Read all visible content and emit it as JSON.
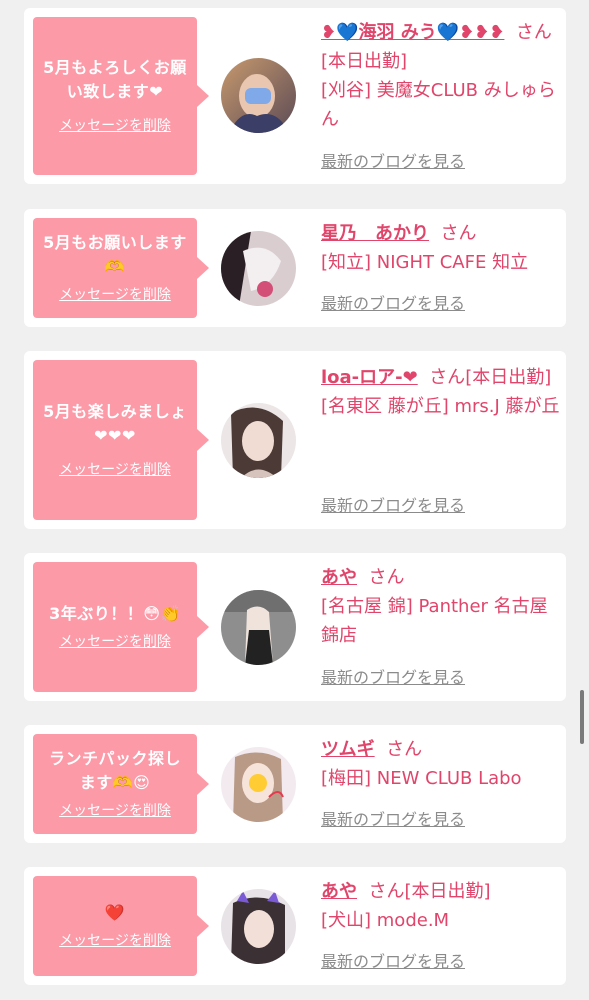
{
  "colors": {
    "page_background": "#f0f0f1",
    "card_background": "#ffffff",
    "bubble_background": "#fc9aa8",
    "accent_pink": "#e0456b",
    "link_gray": "#8b8b8b"
  },
  "labels": {
    "delete_message": "メッセージを削除",
    "latest_blog": "最新のブログを見る",
    "honorific": "さん"
  },
  "entries": [
    {
      "message": "5月もよろしくお願い致します❤",
      "name": "❥💙海羽 みう💙❥❥❥",
      "status": "[本日出勤]",
      "location": "[刈谷] 美魔女CLUB みしゅらん",
      "avatar_icon": "photo-avatar-icon"
    },
    {
      "message": "5月もお願いします🫶",
      "name": "星乃　あかり",
      "status": "",
      "location": "[知立] NIGHT CAFE 知立",
      "avatar_icon": "photo-avatar-icon"
    },
    {
      "message": "5月も楽しみましょ❤❤❤",
      "name": "loa-ロア-❤",
      "status": "[本日出勤]",
      "location": "[名東区 藤が丘] mrs.J 藤が丘",
      "avatar_icon": "photo-avatar-icon"
    },
    {
      "message": "3年ぶり！！😳👏",
      "name": "あや",
      "status": "",
      "location": "[名古屋 錦] Panther 名古屋錦店",
      "avatar_icon": "photo-avatar-icon"
    },
    {
      "message": "ランチパック探します🫶😍",
      "name": "ツムギ",
      "status": "",
      "location": "[梅田] NEW CLUB Labo",
      "avatar_icon": "photo-avatar-icon"
    },
    {
      "message": "❤️",
      "name": "あや",
      "status": "[本日出勤]",
      "location": "[犬山] mode.M",
      "avatar_icon": "photo-avatar-icon"
    }
  ]
}
